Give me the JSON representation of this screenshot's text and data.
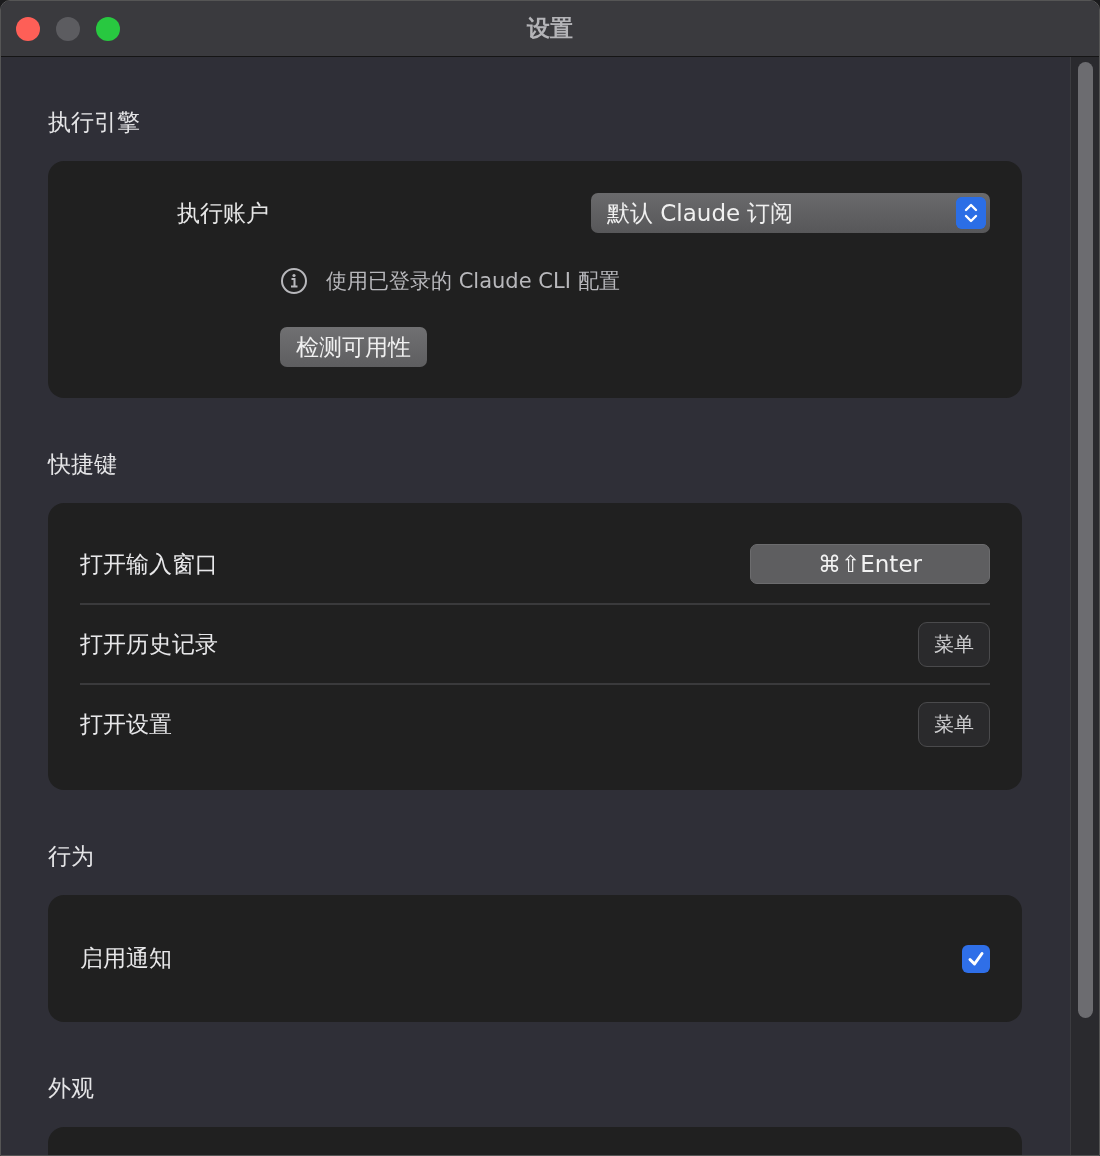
{
  "window": {
    "title": "设置"
  },
  "sections": [
    {
      "title": "执行引擎",
      "kind": "engine",
      "account": {
        "label": "执行账户",
        "value": "默认 Claude 订阅"
      },
      "info": "使用已登录的 Claude CLI 配置",
      "button": "检测可用性"
    },
    {
      "title": "快捷键",
      "kind": "rows",
      "rows": [
        {
          "kind": "shortcut",
          "label": "打开输入窗口",
          "value": "⌘⇧Enter"
        },
        {
          "kind": "menu",
          "label": "打开历史记录",
          "button": "菜单"
        },
        {
          "kind": "menu",
          "label": "打开设置",
          "button": "菜单"
        }
      ]
    },
    {
      "title": "行为",
      "kind": "rows",
      "rows": [
        {
          "kind": "checkbox",
          "label": "启用通知",
          "checked": true
        }
      ]
    },
    {
      "title": "外观",
      "kind": "empty"
    }
  ]
}
